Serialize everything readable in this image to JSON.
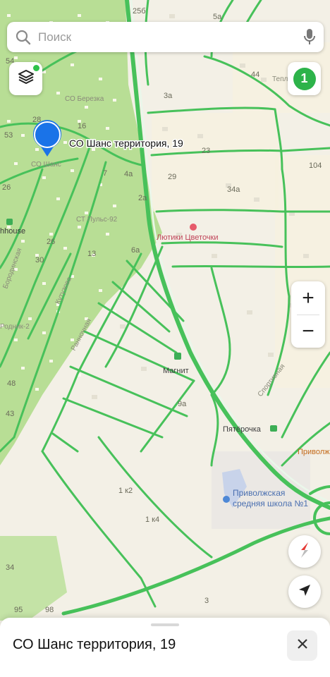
{
  "search": {
    "placeholder": "Поиск",
    "mic_icon": "microphone-icon",
    "search_icon": "search-icon"
  },
  "controls": {
    "layers_icon": "layers-icon",
    "notification_count": "1",
    "zoom_in": "+",
    "zoom_out": "−",
    "compass_icon": "compass-icon",
    "locate_icon": "navigation-arrow-icon"
  },
  "map": {
    "selected_place": "СО Шанс территория, 19",
    "places": {
      "sns": "СО Шанс",
      "berezka": "СО Березка",
      "pulse": "СТ Пульс-92",
      "lyutiki": "Лютики Цветочки",
      "magnit": "Магнит",
      "pyaterochka": "Пятёрочка",
      "school_l1": "Приволжская",
      "school_l2": "средняя школа №1",
      "privolzh_edge": "Приволж",
      "house_edge": "hhouse",
      "rodnik": "Родник-2"
    },
    "streets": {
      "kutuzova": "Кутузова",
      "rannyaya": "Ранночная",
      "sportivnaya": "Спортивная",
      "borodinskaya": "Бородинская",
      "teplichnaya": "Тепличная"
    },
    "numbers": {
      "n25b": "25б",
      "n5a": "5а",
      "n54": "54",
      "n44": "44",
      "n3a": "3а",
      "n28": "28",
      "n16": "16",
      "n53": "53",
      "n23": "23",
      "n104": "104",
      "n7": "7",
      "n4a": "4а",
      "n29": "29",
      "n34a": "34а",
      "n26a": "26",
      "n2a": "2а",
      "n26b": "26",
      "n13": "13",
      "n6a": "6а",
      "n30": "30",
      "n9a": "9а",
      "n48": "48",
      "n43": "43",
      "n1k2": "1 к2",
      "n1k4": "1 к4",
      "n34": "34",
      "n95": "95",
      "n98": "98",
      "n3": "3"
    }
  },
  "sheet": {
    "title": "СО Шанс территория, 19",
    "close_icon": "close-icon"
  },
  "colors": {
    "road": "#47c15a",
    "forest": "#b6de92",
    "land": "#f3f0e6",
    "pin": "#1a73e8",
    "accent": "#2db34a"
  }
}
